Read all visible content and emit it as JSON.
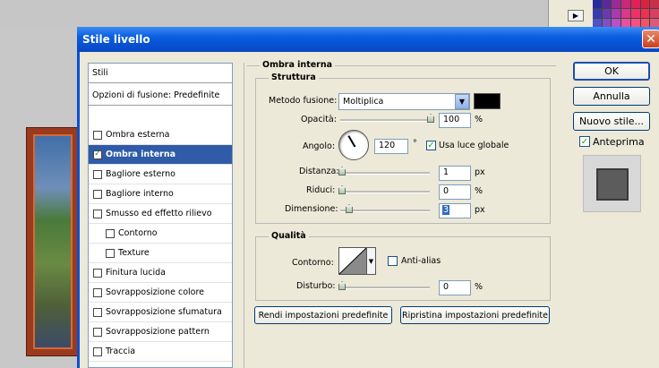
{
  "dialog": {
    "title": "Stile livello",
    "close_glyph": "✕"
  },
  "styles_panel": {
    "header": "Stili",
    "blend_options": "Opzioni di fusione: Predefinite",
    "items": [
      {
        "label": "Ombra esterna",
        "checked": false
      },
      {
        "label": "Ombra interna",
        "checked": true,
        "selected": true
      },
      {
        "label": "Bagliore esterno",
        "checked": false
      },
      {
        "label": "Bagliore interno",
        "checked": false
      },
      {
        "label": "Smusso ed effetto rilievo",
        "checked": false
      },
      {
        "label": "Contorno",
        "checked": false,
        "sub": true
      },
      {
        "label": "Texture",
        "checked": false,
        "sub": true
      },
      {
        "label": "Finitura lucida",
        "checked": false
      },
      {
        "label": "Sovrapposizione colore",
        "checked": false
      },
      {
        "label": "Sovrapposizione sfumatura",
        "checked": false
      },
      {
        "label": "Sovrapposizione pattern",
        "checked": false
      },
      {
        "label": "Traccia",
        "checked": false
      }
    ]
  },
  "settings": {
    "section_title": "Ombra interna",
    "structure": {
      "title": "Struttura",
      "blend_mode_label": "Metodo fusione:",
      "blend_mode_value": "Moltiplica",
      "shadow_color": "#000000",
      "opacity_label": "Opacità:",
      "opacity_value": "100",
      "opacity_unit": "%",
      "angle_label": "Angolo:",
      "angle_value": "120",
      "angle_unit": "°",
      "global_light_label": "Usa luce globale",
      "global_light_checked": true,
      "distance_label": "Distanza:",
      "distance_value": "1",
      "distance_unit": "px",
      "choke_label": "Riduci:",
      "choke_value": "0",
      "choke_unit": "%",
      "size_label": "Dimensione:",
      "size_value": "3",
      "size_unit": "px"
    },
    "quality": {
      "title": "Qualità",
      "contour_label": "Contorno:",
      "antialias_label": "Anti-alias",
      "antialias_checked": false,
      "noise_label": "Disturbo:",
      "noise_value": "0",
      "noise_unit": "%"
    },
    "make_default_label": "Rendi impostazioni predefinite",
    "reset_default_label": "Ripristina impostazioni predefinite"
  },
  "actions": {
    "ok_label": "OK",
    "cancel_label": "Annulla",
    "new_style_label": "Nuovo stile...",
    "preview_label": "Anteprima",
    "preview_checked": true
  },
  "colors": {
    "titlebar": "#0a5ee0",
    "selected_row": "#2f5ba8",
    "dialog_bg": "#ece9d8"
  }
}
